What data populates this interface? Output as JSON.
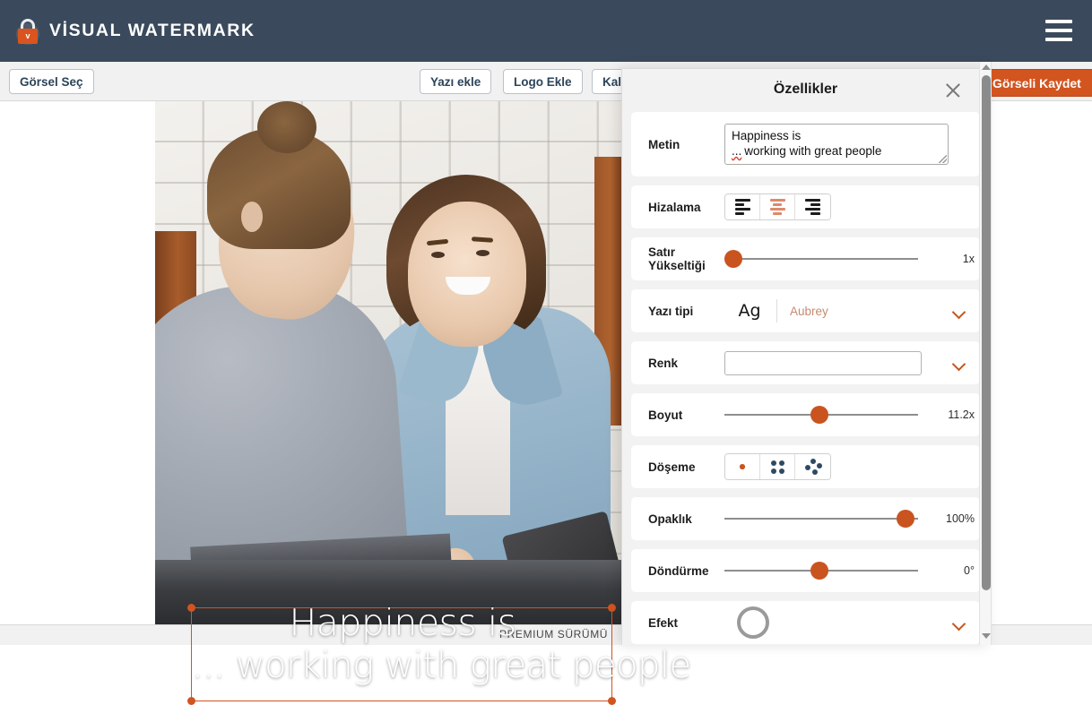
{
  "topbar": {
    "brand_name": "VİSUAL WATERMARK",
    "logo_letter": "v",
    "logo_icon": "lock-icon",
    "menu_icon": "hamburger-icon",
    "bg_color": "#3a4a5c"
  },
  "toolbar": {
    "select_image_label": "Görsel Seç",
    "add_text_label": "Yazı ekle",
    "add_logo_label": "Logo Ekle",
    "remaining_label": "Kal",
    "save_image_label": "Görseli Kaydet",
    "save_color": "#d2541f"
  },
  "canvas": {
    "watermark_line1": "Happiness is",
    "watermark_line2": "... working with great people",
    "selection_color": "#d2541f"
  },
  "statusbar": {
    "premium_label": "PREMIUM SÜRÜMÜ"
  },
  "panel": {
    "title": "Özellikler",
    "close_icon": "close-icon",
    "rows": {
      "metin": {
        "label": "Metin",
        "value_line1": "Happiness is",
        "value_dots": "...",
        "value_line2": "working with great people"
      },
      "hizalama": {
        "label": "Hizalama",
        "options": [
          "align-left",
          "align-center",
          "align-right"
        ],
        "selected": "align-center"
      },
      "satir_yuksekligi": {
        "label": "Satır Yükseltiği",
        "value": "1x",
        "knob_percent": 0
      },
      "yazi_tipi": {
        "label": "Yazı tipi",
        "preview": "Ag",
        "font_name": "Aubrey",
        "chevron_icon": "chevron-down-icon"
      },
      "renk": {
        "label": "Renk",
        "swatch_color": "#ffffff",
        "chevron_icon": "chevron-down-icon"
      },
      "boyut": {
        "label": "Boyut",
        "value": "11.2x",
        "knob_percent": 49
      },
      "doseme": {
        "label": "Döşeme",
        "options": [
          "tile-single",
          "tile-grid",
          "tile-scatter"
        ],
        "selected": "tile-single"
      },
      "opaklik": {
        "label": "Opaklık",
        "value": "100%",
        "knob_percent": 96
      },
      "dondurme": {
        "label": "Döndürme",
        "value": "0°",
        "knob_percent": 49
      },
      "efekt": {
        "label": "Efekt",
        "chevron_icon": "chevron-down-icon"
      }
    }
  },
  "scrollbar": {
    "up_icon": "arrow-up-icon",
    "down_icon": "arrow-down-icon"
  }
}
